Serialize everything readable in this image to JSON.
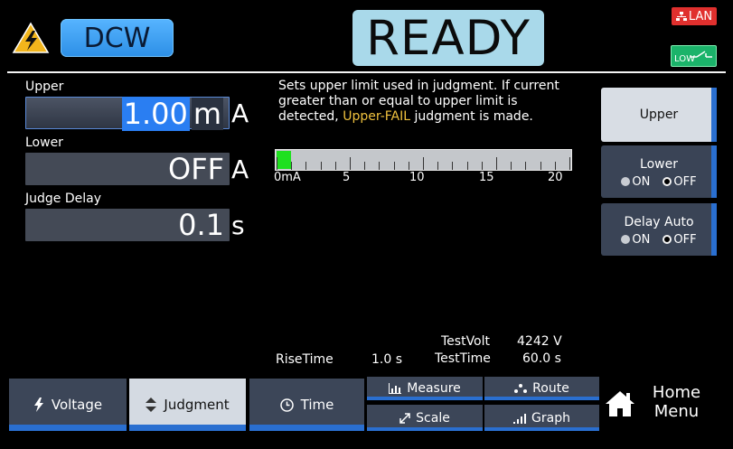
{
  "header": {
    "mode": "DCW",
    "status": "READY",
    "lan_label": "LAN",
    "low_label": "LOW"
  },
  "params": {
    "upper": {
      "label": "Upper",
      "value": "1.00",
      "cursor_unit": "m",
      "unit": "A"
    },
    "lower": {
      "label": "Lower",
      "value": "OFF",
      "unit": "A"
    },
    "judge_delay": {
      "label": "Judge Delay",
      "value": "0.1",
      "unit": "s"
    }
  },
  "help": {
    "line1": "Sets upper limit used in judgment. If current",
    "line2": "greater than or equal to upper limit is",
    "line3_prefix": "detected, ",
    "line3_highlight": "Upper-FAIL",
    "line3_suffix": " judgment is made."
  },
  "meter": {
    "fill_fraction": 0.0,
    "labels": [
      "0mA",
      "5",
      "10",
      "15",
      "20"
    ]
  },
  "side": {
    "upper_label": "Upper",
    "lower": {
      "label": "Lower",
      "on": "ON",
      "off": "OFF",
      "selected": "OFF"
    },
    "delay_auto": {
      "label": "Delay Auto",
      "on": "ON",
      "off": "OFF",
      "selected": "OFF"
    }
  },
  "readouts": {
    "rise_time_label": "RiseTime",
    "rise_time_value": "1.0 s",
    "test_volt_label": "TestVolt",
    "test_volt_value": "4242 V",
    "test_time_label": "TestTime",
    "test_time_value": "60.0 s"
  },
  "tabs": {
    "voltage": "Voltage",
    "judgment": "Judgment",
    "time": "Time",
    "measure": "Measure",
    "scale": "Scale",
    "route": "Route",
    "graph": "Graph",
    "home_line1": "Home",
    "home_line2": "Menu"
  },
  "colors": {
    "accent_blue": "#2a6fd0",
    "status_bg": "#a9d9ea",
    "lan_red": "#e0302e",
    "low_green": "#1bb36a",
    "highlight_yellow": "#f0c23e"
  }
}
